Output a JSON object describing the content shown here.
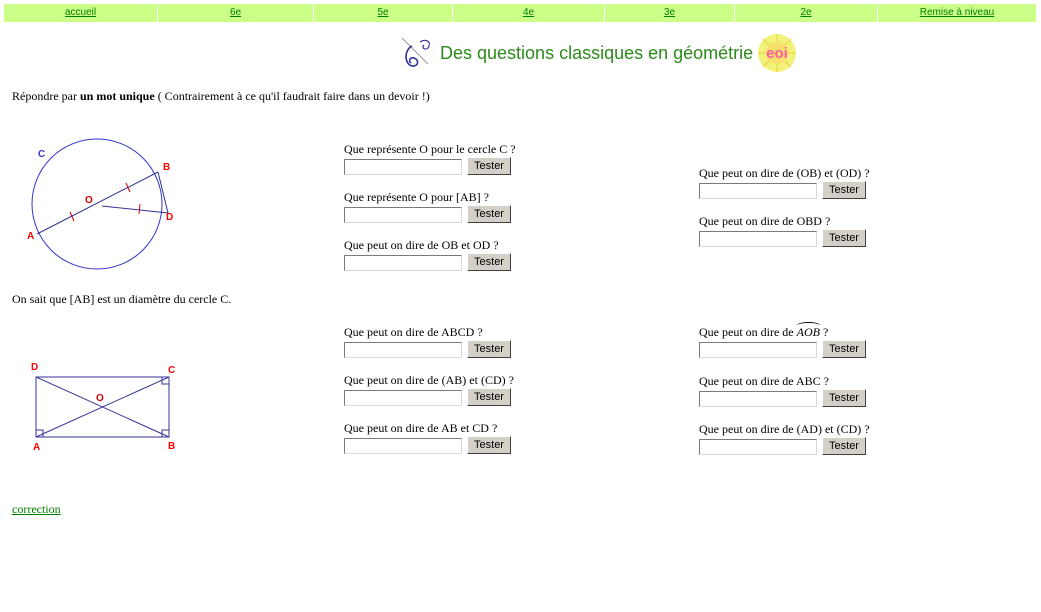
{
  "nav": {
    "items": [
      {
        "label": "accueil"
      },
      {
        "label": "6e"
      },
      {
        "label": "5e"
      },
      {
        "label": "4e"
      },
      {
        "label": "3e"
      },
      {
        "label": "2e"
      },
      {
        "label": "Remise à niveau"
      }
    ]
  },
  "header": {
    "title": "Des questions classiques en géométrie"
  },
  "intro": {
    "prefix": "Répondre par ",
    "bold": "un mot unique",
    "suffix": " ( Contrairement à ce qu'il faudrait faire dans un devoir !)"
  },
  "figure1": {
    "labels": {
      "c": "C",
      "b": "B",
      "o": "O",
      "a": "A",
      "d": "D"
    }
  },
  "note": "On sait que [AB] est un diamètre du cercle C.",
  "figure2": {
    "labels": {
      "d": "D",
      "c": "C",
      "o": "O",
      "a": "A",
      "b": "B"
    }
  },
  "button_label": "Tester",
  "questions": {
    "q1": "Que représente O pour le cercle C ?",
    "q2": "Que représente O pour [AB] ?",
    "q3": "Que peut on dire de OB et OD ?",
    "q4": "Que peut on dire de (OB) et (OD) ?",
    "q5": "Que peut on dire de OBD ?",
    "q6": "Que peut on dire de ABCD ?",
    "q7": "Que peut on dire de (AB) et (CD) ?",
    "q8": "Que peut on dire de AB et CD ?",
    "q9_prefix": "Que peut on dire de ",
    "q9_arc": "AOB",
    "q9_suffix": " ?",
    "q10": "Que peut on dire de ABC ?",
    "q11": "Que peut on dire de (AD) et (CD) ?"
  },
  "correction_link": "correction",
  "colors": {
    "nav_bg": "#ccff88",
    "link": "#008000",
    "title": "#2b8a1a",
    "point_label": "#ff0000",
    "circle": "#3333cc"
  }
}
